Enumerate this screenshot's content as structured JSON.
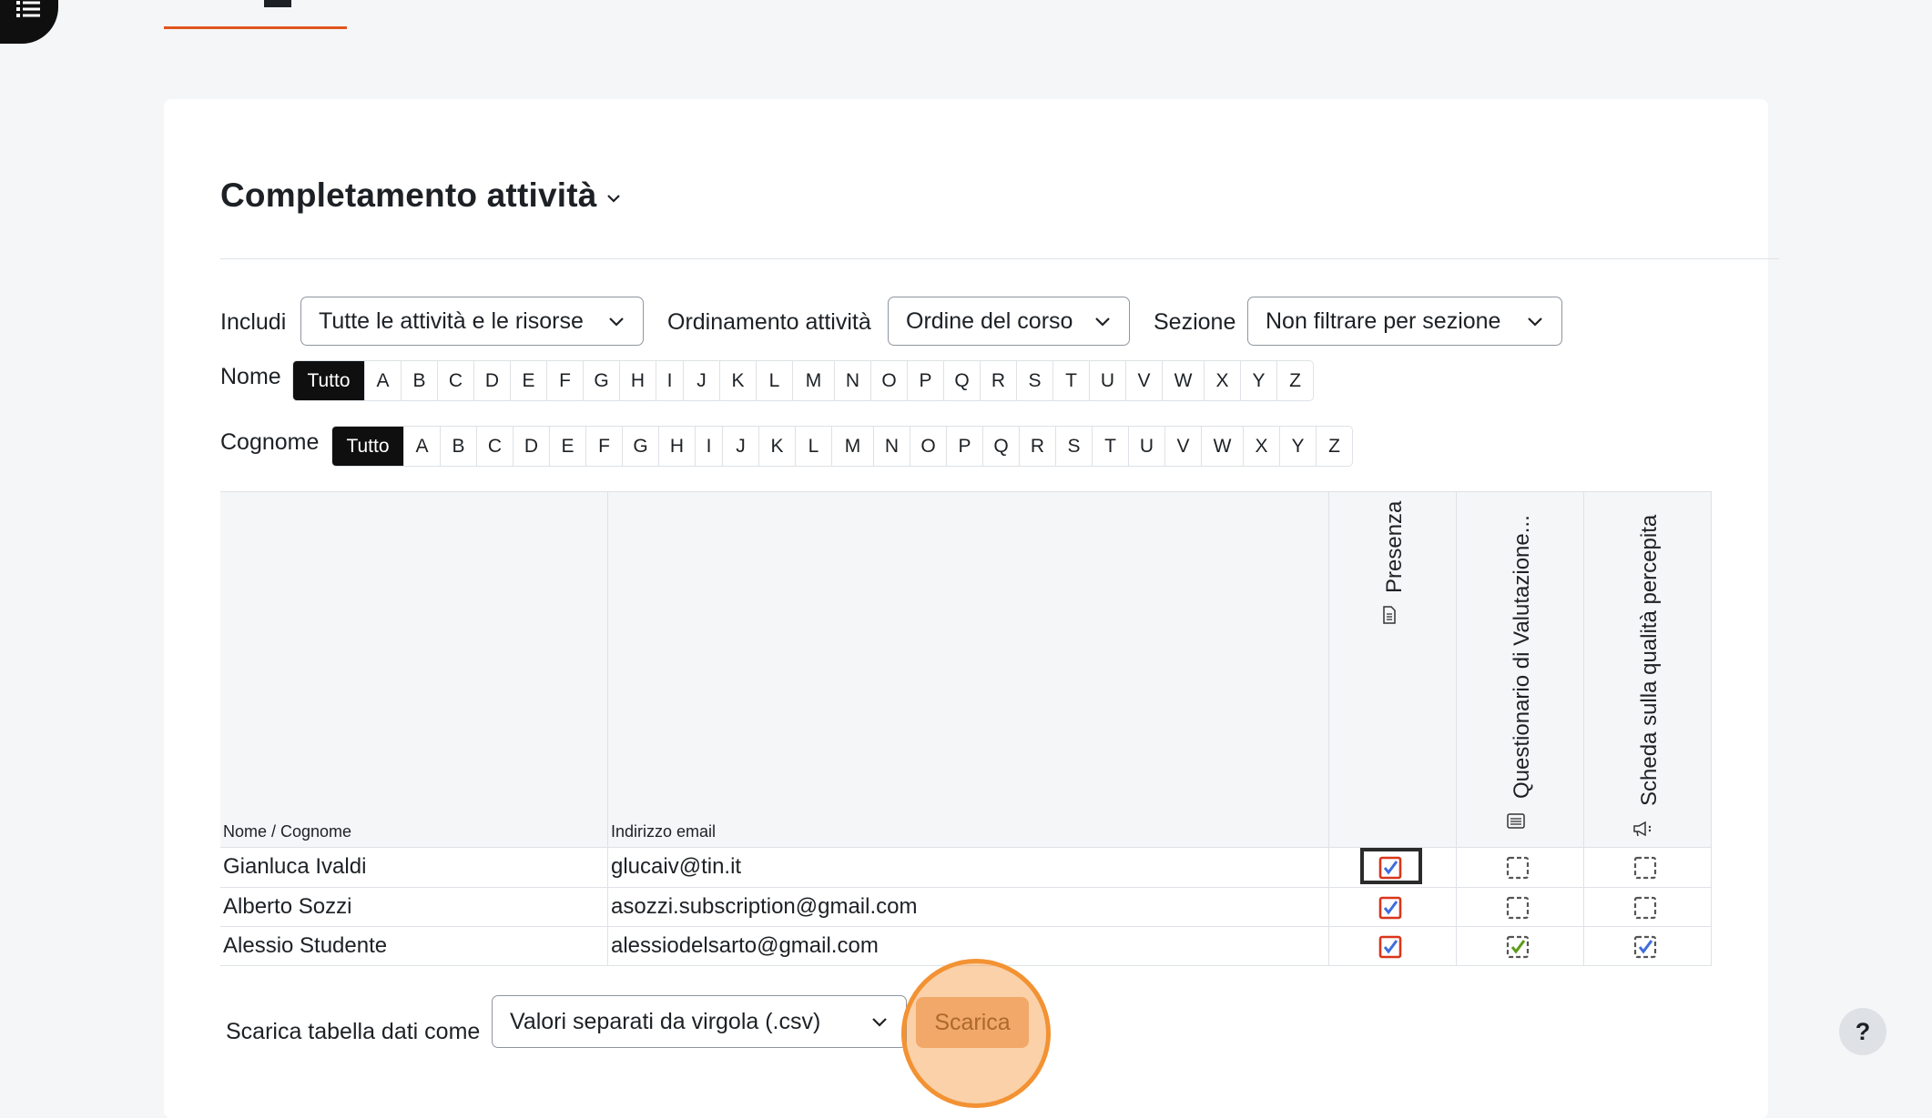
{
  "page": {
    "title": "Completamento attività",
    "colors": {
      "accent": "#e0551f",
      "checkbox_red": "#d9361b",
      "check_blue": "#3d6edc",
      "check_green": "#5b9b17"
    }
  },
  "filters": {
    "include_label": "Includi",
    "include_value": "Tutte le attività e le risorse",
    "order_label": "Ordinamento attività",
    "order_value": "Ordine del corso",
    "section_label": "Sezione",
    "section_value": "Non filtrare per sezione"
  },
  "name_filter": {
    "label": "Nome",
    "letters": [
      "Tutto",
      "A",
      "B",
      "C",
      "D",
      "E",
      "F",
      "G",
      "H",
      "I",
      "J",
      "K",
      "L",
      "M",
      "N",
      "O",
      "P",
      "Q",
      "R",
      "S",
      "T",
      "U",
      "V",
      "W",
      "X",
      "Y",
      "Z"
    ]
  },
  "surname_filter": {
    "label": "Cognome",
    "letters": [
      "Tutto",
      "A",
      "B",
      "C",
      "D",
      "E",
      "F",
      "G",
      "H",
      "I",
      "J",
      "K",
      "L",
      "M",
      "N",
      "O",
      "P",
      "Q",
      "R",
      "S",
      "T",
      "U",
      "V",
      "W",
      "X",
      "Y",
      "Z"
    ]
  },
  "table": {
    "col_name": "Nome / Cognome",
    "col_email": "Indirizzo email",
    "activities": [
      {
        "name": "Presenza",
        "icon": "page-icon"
      },
      {
        "name": "Questionario di Valutazione...",
        "icon": "feedback-icon"
      },
      {
        "name": "Scheda sulla qualità percepita",
        "icon": "megaphone-icon"
      }
    ],
    "rows": [
      {
        "name": "Gianluca Ivaldi",
        "email": "glucaiv@tin.it",
        "status": [
          "complete",
          "incomplete",
          "incomplete"
        ]
      },
      {
        "name": "Alberto Sozzi",
        "email": "asozzi.subscription@gmail.com",
        "status": [
          "complete",
          "incomplete",
          "incomplete"
        ]
      },
      {
        "name": "Alessio Studente",
        "email": "alessiodelsarto@gmail.com",
        "status": [
          "complete",
          "complete-pass",
          "complete-auto"
        ]
      }
    ]
  },
  "download": {
    "label": "Scarica tabella dati come",
    "format": "Valori separati da virgola (.csv)",
    "button": "Scarica"
  },
  "help": {
    "label": "?"
  }
}
